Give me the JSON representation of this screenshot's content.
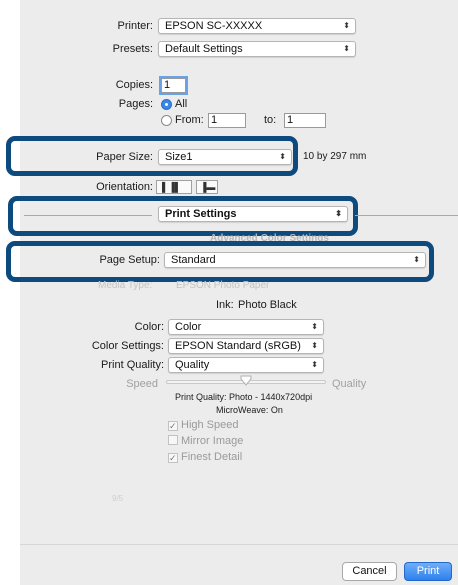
{
  "printer": {
    "label": "Printer:",
    "value": "EPSON SC-XXXXX"
  },
  "presets": {
    "label": "Presets:",
    "value": "Default Settings"
  },
  "copies": {
    "label": "Copies:",
    "value": "1"
  },
  "pages": {
    "label": "Pages:",
    "all": "All",
    "from": "From:",
    "from_value": "1",
    "to": "to:",
    "to_value": "1"
  },
  "paper_size": {
    "label": "Paper Size:",
    "value": "Size1",
    "dims": "10 by 297 mm"
  },
  "orientation": {
    "label": "Orientation:"
  },
  "section_popup": {
    "value": "Print Settings"
  },
  "partial_tab": "Advanced Color Settings",
  "page_setup": {
    "label": "Page Setup:",
    "value": "Standard"
  },
  "media_type": {
    "label": "Media Type:",
    "value": "EPSON Photo Paper"
  },
  "ink": {
    "label": "Ink:",
    "value": "Photo Black"
  },
  "color": {
    "label": "Color:",
    "value": "Color"
  },
  "color_settings": {
    "label": "Color Settings:",
    "value": "EPSON Standard (sRGB)"
  },
  "print_quality": {
    "label": "Print Quality:",
    "value": "Quality"
  },
  "slider": {
    "left": "Speed",
    "right": "Quality",
    "level": 0.5
  },
  "quality_info": "Print Quality: Photo - 1440x720dpi",
  "microweave": "MicroWeave: On",
  "options": [
    {
      "label": "High Speed",
      "checked": true
    },
    {
      "label": "Mirror Image",
      "checked": false
    },
    {
      "label": "Finest Detail",
      "checked": true
    }
  ],
  "faint_text": "9/5",
  "buttons": {
    "cancel": "Cancel",
    "print": "Print"
  },
  "colors": {
    "highlight": "#0d4a7e",
    "accent": "#2d81ee"
  }
}
